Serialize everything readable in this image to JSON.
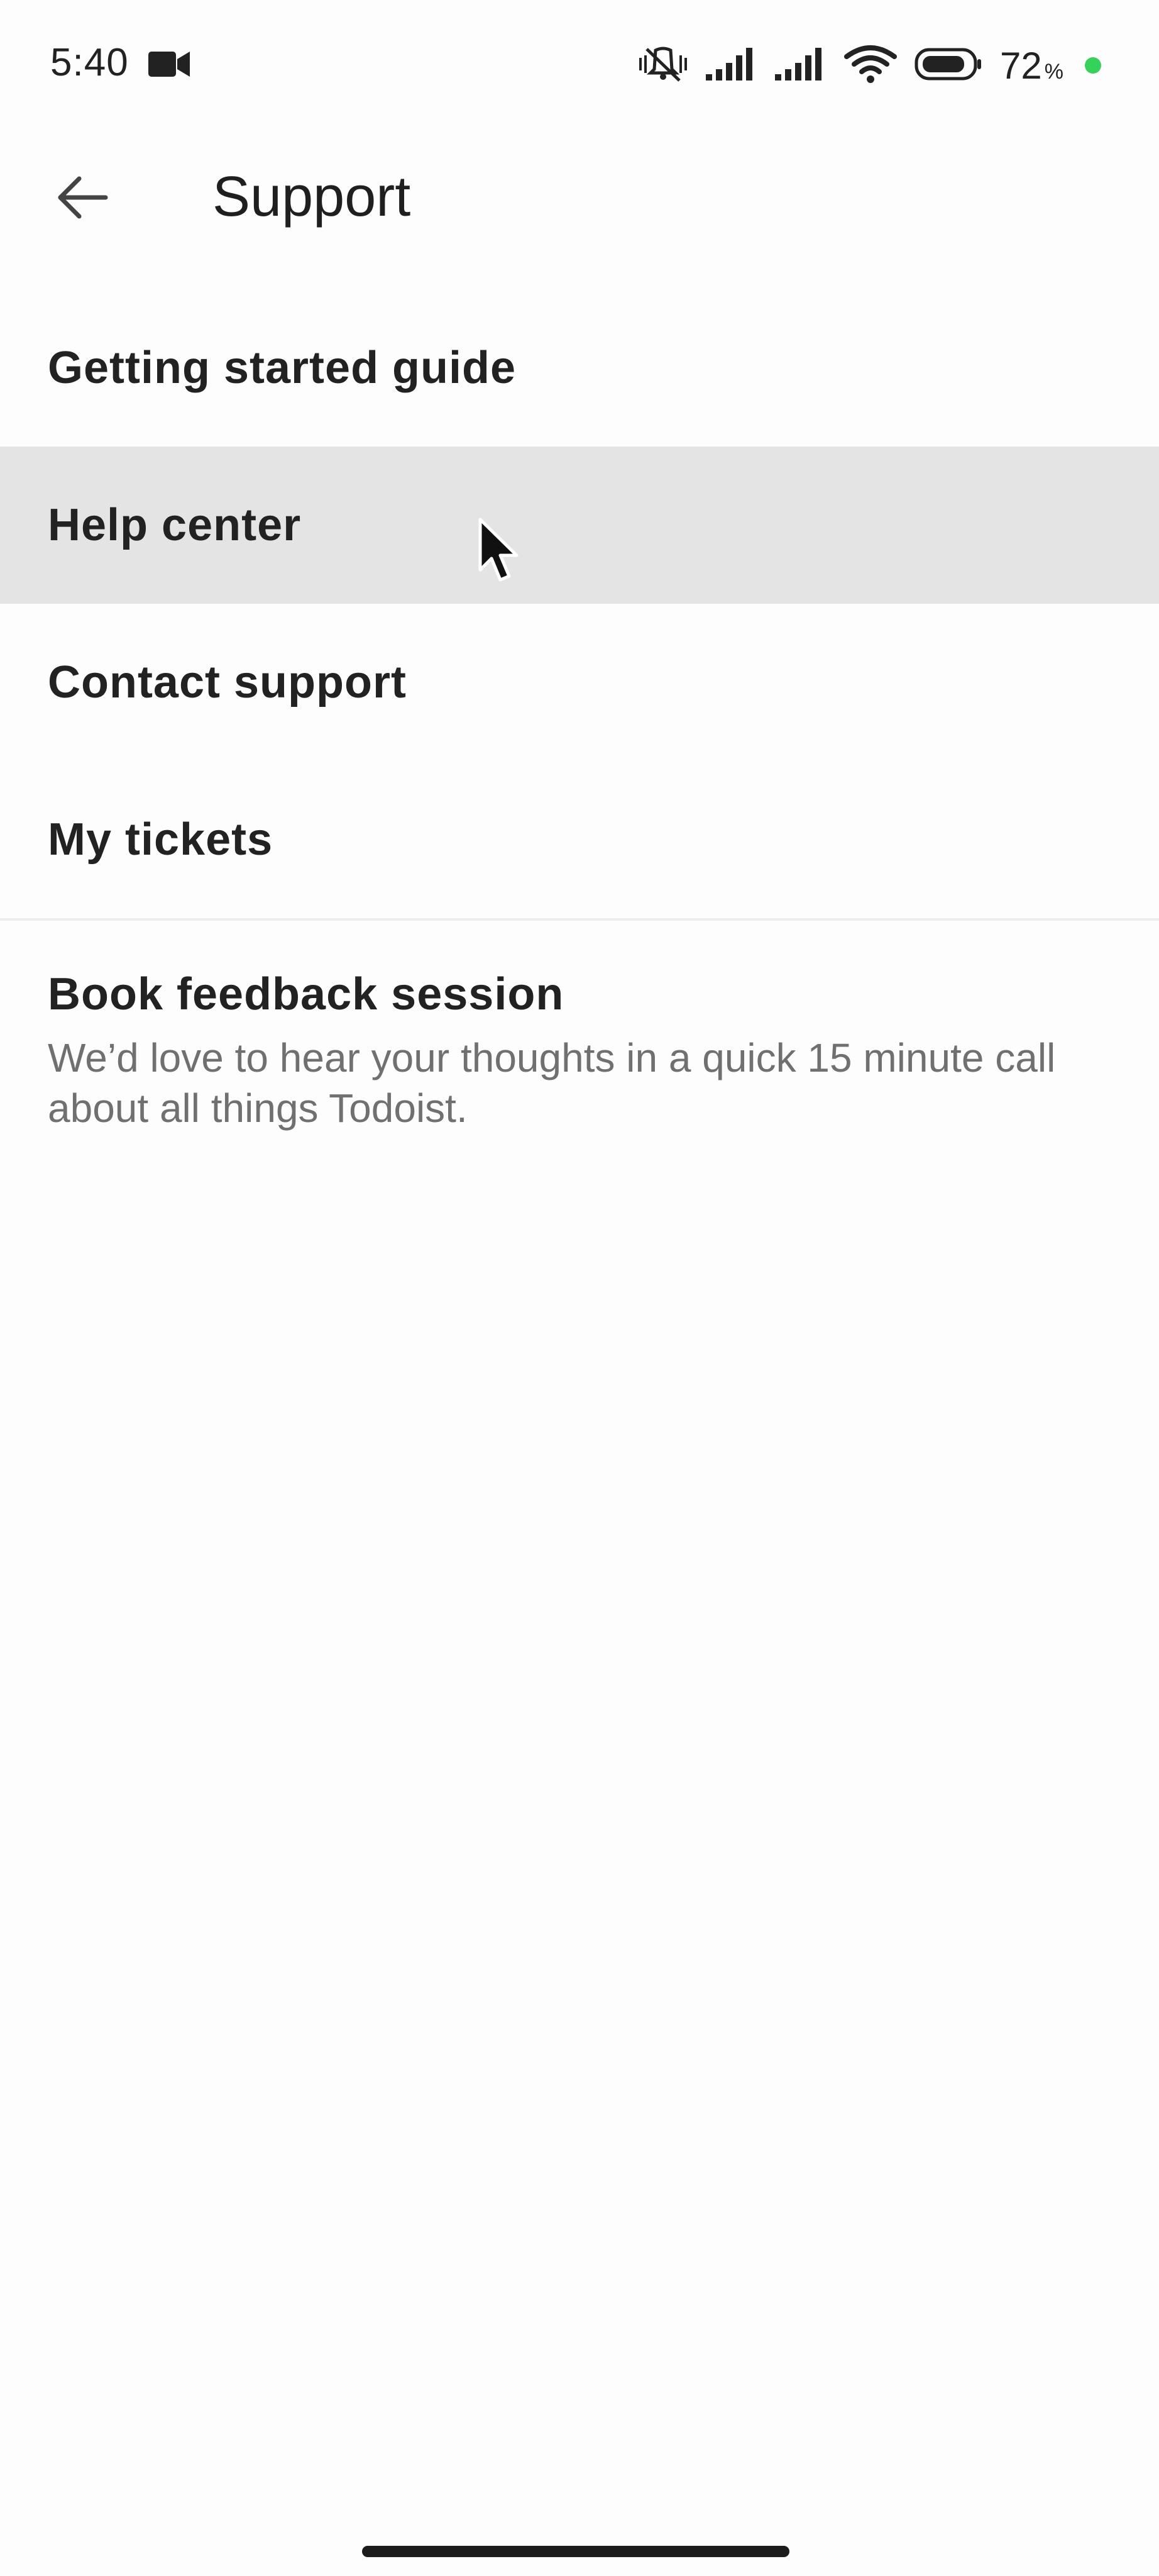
{
  "status_bar": {
    "time": "5:40",
    "battery_percent": "72",
    "battery_unit": "%",
    "icons": [
      "video-camera-icon",
      "mute-vibrate-icon",
      "signal-icon",
      "signal-icon",
      "wifi-icon",
      "battery-icon",
      "charging-dot-icon"
    ],
    "charge_color": "#35d25a"
  },
  "header": {
    "back_icon": "arrow-left-icon",
    "title": "Support"
  },
  "menu": {
    "items": [
      {
        "label": "Getting started guide"
      },
      {
        "label": "Help center",
        "highlighted": true
      },
      {
        "label": "Contact support"
      },
      {
        "label": "My tickets"
      }
    ],
    "feedback": {
      "title": "Book feedback session",
      "description": "We’d love to hear your thoughts in a quick 15 minute call about all things Todoist."
    }
  },
  "colors": {
    "highlight": "#e4e4e4",
    "text_primary": "#222222",
    "text_secondary": "#707070"
  }
}
